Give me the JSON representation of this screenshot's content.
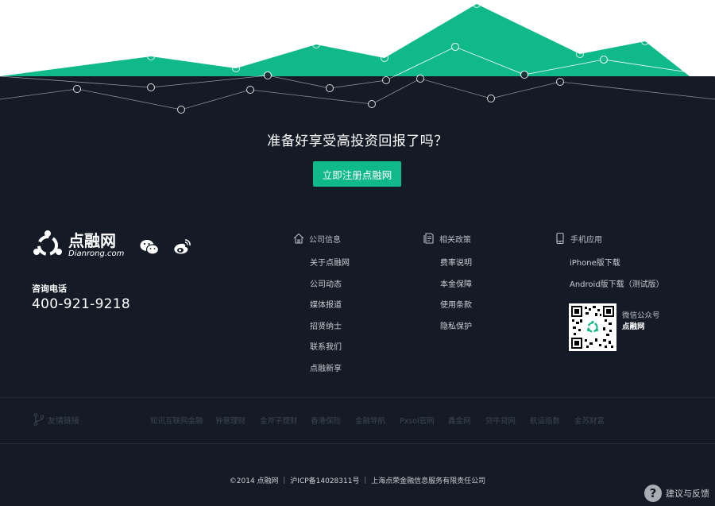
{
  "hero": {
    "cta_title": "准备好享受高投资回报了吗？",
    "cta_button": "立即注册点融网",
    "accent_color": "#10b98a"
  },
  "brand": {
    "name_cn": "点融网",
    "name_en": "Dianrong.com"
  },
  "social": {
    "icons": [
      "wechat-icon",
      "weibo-icon"
    ]
  },
  "hotline": {
    "label": "咨询电话",
    "number": "400-921-9218"
  },
  "columns": {
    "company": {
      "title": "公司信息",
      "icon": "home-icon",
      "items": [
        "关于点融网",
        "公司动态",
        "媒体报道",
        "招贤纳士",
        "联系我们",
        "点融新享"
      ]
    },
    "policy": {
      "title": "相关政策",
      "icon": "document-icon",
      "items": [
        "费率说明",
        "本金保障",
        "使用条款",
        "隐私保护"
      ]
    },
    "mobile": {
      "title": "手机应用",
      "icon": "phone-icon",
      "items": [
        "iPhone版下载",
        "Android版下载（测试版）"
      ],
      "qr_label": "微信公众号",
      "qr_name": "点融网"
    }
  },
  "friend_links": {
    "title": "友情链接",
    "items": [
      "知讯互联网金融",
      "钟意理财",
      "金斧子理财",
      "香港保险",
      "金融导航",
      "Pxsol官网",
      "鑫金网",
      "贷牛贷网",
      "航运指数",
      "金苏财富"
    ]
  },
  "footer": {
    "copyright": "©2014 点融网  ｜  沪ICP备14028311号  ｜  上海点荣金融信息服务有限责任公司"
  },
  "feedback": {
    "icon": "?",
    "label": "建议与反馈"
  }
}
